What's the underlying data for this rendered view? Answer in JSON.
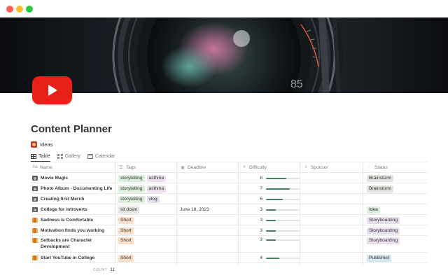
{
  "window": {
    "controls": [
      "close",
      "minimize",
      "zoom"
    ]
  },
  "cover": {
    "description_icon": "camera-lens-cover",
    "lens_marking": "85"
  },
  "page": {
    "icon": "youtube-play-icon",
    "title": "Content Planner",
    "link_label": "Ideas"
  },
  "views": [
    {
      "label": "Table",
      "icon": "table-icon",
      "active": true
    },
    {
      "label": "Gallery",
      "icon": "gallery-icon",
      "active": false
    },
    {
      "label": "Calendar",
      "icon": "calendar-icon",
      "active": false
    }
  ],
  "table": {
    "columns": [
      {
        "label": "Name",
        "icon": "text-icon"
      },
      {
        "label": "Tags",
        "icon": "multi-select-icon"
      },
      {
        "label": "Deadline",
        "icon": "date-icon"
      },
      {
        "label": "Difficulty",
        "icon": "number-icon"
      },
      {
        "label": "Sponsor",
        "icon": "text-lines-icon"
      },
      {
        "label": "Status",
        "icon": "status-icon"
      }
    ],
    "rows": [
      {
        "name": "Movie Magic",
        "emoji": "camera",
        "tags": [
          "storytelling",
          "asthma"
        ],
        "deadline": "",
        "difficulty": 6,
        "sponsor": "",
        "status": "Brainstorm"
      },
      {
        "name": "Photo Album - Documenting Life",
        "emoji": "camera",
        "tags": [
          "storytelling",
          "asthma"
        ],
        "deadline": "",
        "difficulty": 7,
        "sponsor": "",
        "status": "Brainstorm"
      },
      {
        "name": "Creating first Merch",
        "emoji": "camera",
        "tags": [
          "storytelling",
          "vlog"
        ],
        "deadline": "",
        "difficulty": 5,
        "sponsor": "",
        "status": ""
      },
      {
        "name": "College for introverts",
        "emoji": "camera",
        "tags": [
          "sit down"
        ],
        "deadline": "June 18, 2023",
        "difficulty": 3,
        "sponsor": "",
        "status": "Idea"
      },
      {
        "name": "Sadness is Comfortable",
        "emoji": "books",
        "tags": [
          "Short"
        ],
        "deadline": "",
        "difficulty": 3,
        "sponsor": "",
        "status": "Storyboarding"
      },
      {
        "name": "Motivation finds you working",
        "emoji": "books",
        "tags": [
          "Short"
        ],
        "deadline": "",
        "difficulty": 3,
        "sponsor": "",
        "status": "Storyboarding"
      },
      {
        "name": "Setbacks are Character Development",
        "emoji": "books",
        "tags": [
          "Short"
        ],
        "deadline": "",
        "difficulty": 3,
        "sponsor": "",
        "status": "Storyboarding"
      },
      {
        "name": "Start YouTube in College",
        "emoji": "books",
        "tags": [
          "Short"
        ],
        "deadline": "",
        "difficulty": 4,
        "sponsor": "",
        "status": "Published"
      }
    ],
    "difficulty_max": 10,
    "count_label": "COUNT",
    "count_value": "11"
  },
  "colors": {
    "tag_storytelling": "#dbeddb",
    "tag_asthma": "#e8deee",
    "tag_vlog": "#e8deee",
    "tag_sit_down": "#e3e2e0",
    "tag_short": "#fadec9",
    "status_brainstorm": "#e3e2e0",
    "status_idea": "#dbeddb",
    "status_storyboarding": "#e8deee",
    "status_published": "#d3e5ef",
    "difficulty_bar": "#448361"
  }
}
